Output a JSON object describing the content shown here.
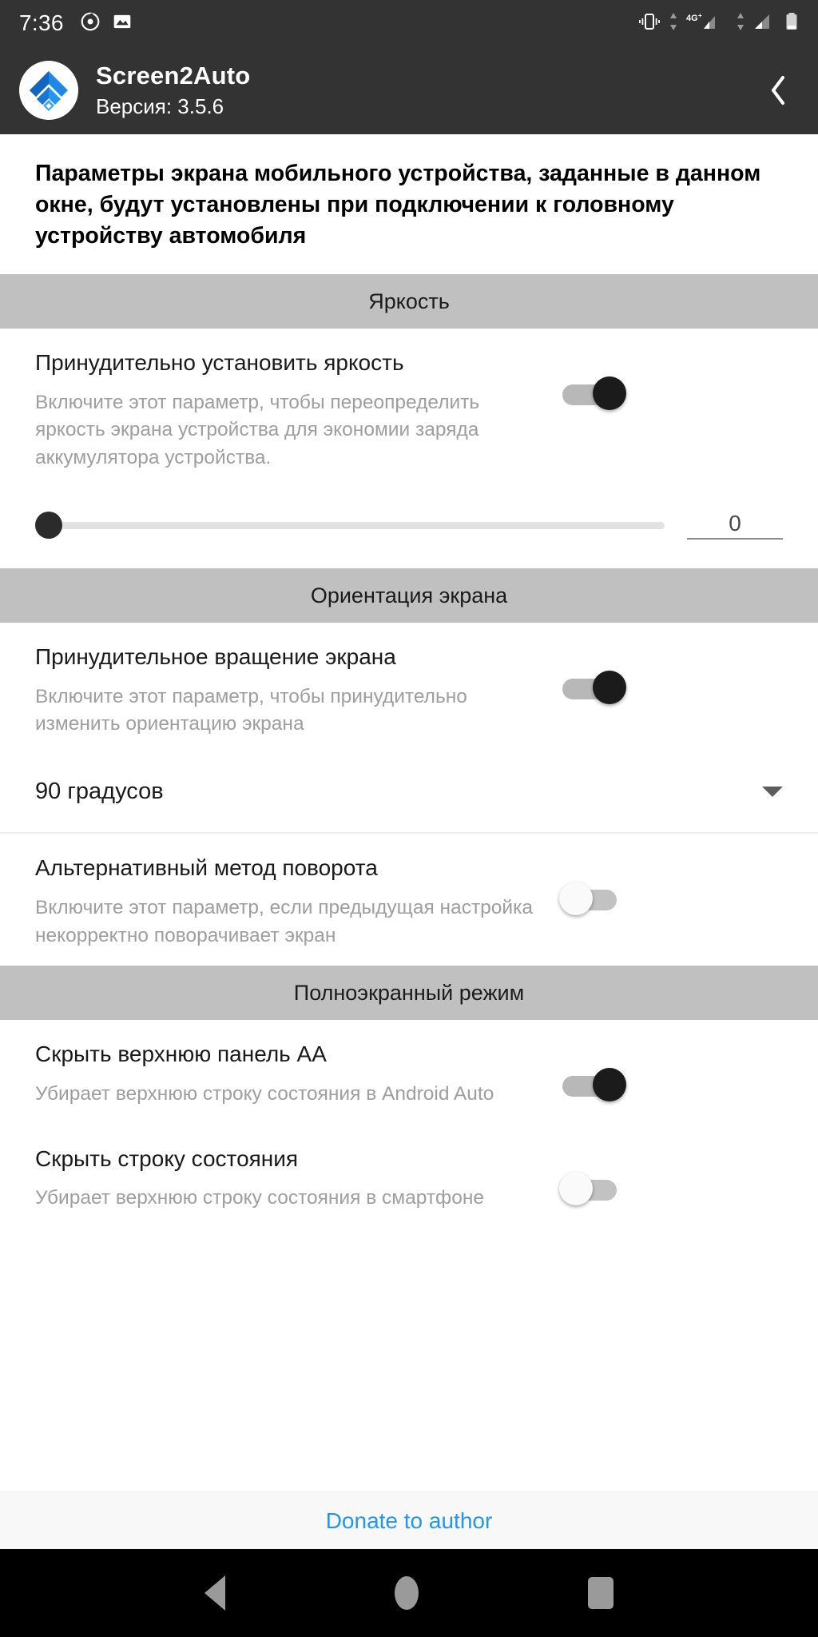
{
  "status_bar": {
    "time": "7:36",
    "left_icons": [
      "record-circle-icon",
      "image-icon"
    ],
    "right_icons": [
      "vibrate-icon",
      "data-arrows-icon",
      "signal-4g-plus-icon",
      "data-arrows-icon-2",
      "signal-bars-icon",
      "battery-icon"
    ],
    "network_label": "4G",
    "network_superscript": "+",
    "background": "#333333"
  },
  "app_bar": {
    "logo_icon": "screen2auto-logo-icon",
    "title": "Screen2Auto",
    "version": "Версия: 3.5.6",
    "back_icon": "chevron-left-icon",
    "background": "#333333"
  },
  "intro": {
    "text": "Параметры экрана мобильного устройства, заданные в данном окне, будут установлены при подключении к головному устройству автомобиля"
  },
  "sections": [
    {
      "header": "Яркость",
      "rows": [
        {
          "title": "Принудительно установить яркость",
          "description": "Включите этот параметр, чтобы переопределить яркость экрана устройства для экономии заряда аккумулятора устройства.",
          "toggle": "on"
        }
      ],
      "slider": {
        "value": "0",
        "position_percent": 0,
        "min": 0,
        "max": 100
      }
    },
    {
      "header": "Ориентация экрана",
      "rows": [
        {
          "title": "Принудительное вращение экрана",
          "description": "Включите этот параметр, чтобы принудительно изменить ориентацию экрана",
          "toggle": "on"
        },
        {
          "title": "Альтернативный метод поворота",
          "description": "Включите этот параметр, если предыдущая настройка некорректно поворачивает экран",
          "toggle": "off"
        }
      ],
      "dropdown": {
        "selected": "90 градусов",
        "caret_icon": "caret-down-icon"
      }
    },
    {
      "header": "Полноэкранный режим",
      "rows": [
        {
          "title": "Скрыть верхнюю панель AA",
          "description": "Убирает верхнюю строку состояния в Android Auto",
          "toggle": "on"
        },
        {
          "title": "Скрыть строку состояния",
          "description": "Убирает верхнюю строку состояния в смартфоне",
          "toggle": "off"
        }
      ]
    }
  ],
  "footer": {
    "donate_label": "Donate to author",
    "link_color": "#2196f3"
  },
  "nav_bar": {
    "back_icon": "nav-back-triangle-icon",
    "home_icon": "nav-home-circle-icon",
    "recents_icon": "nav-recents-square-icon",
    "background": "#000000"
  },
  "colors": {
    "section_header_bg": "#c0c0c0",
    "toggle_on_thumb": "#1b1b1b",
    "toggle_off_thumb": "#fafafa",
    "description_text": "#9e9e9e"
  }
}
